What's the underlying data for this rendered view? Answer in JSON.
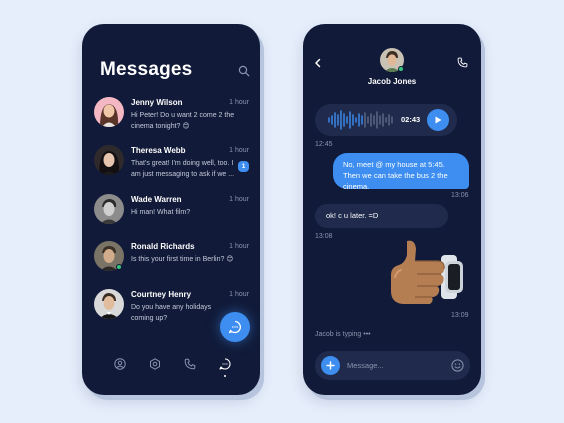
{
  "messages_screen": {
    "title": "Messages",
    "conversations": [
      {
        "name": "Jenny Wilson",
        "time": "1 hour",
        "preview": "Hi Peter! Do u want 2 come 2 the\ncinema tonight? 😊",
        "unread": "",
        "online": false
      },
      {
        "name": "Theresa Webb",
        "time": "1 hour",
        "preview": "That's great! I'm doing well, too. I\nam just messaging to ask if we ...",
        "unread": "1",
        "online": false
      },
      {
        "name": "Wade Warren",
        "time": "1 hour",
        "preview": "Hi man! What film?",
        "unread": "",
        "online": false
      },
      {
        "name": "Ronald Richards",
        "time": "1 hour",
        "preview": "Is this your first time in Berlin? 😊",
        "unread": "",
        "online": true
      },
      {
        "name": "Courtney Henry",
        "time": "1 hour",
        "preview": "Do you have any holidays\ncoming up?",
        "unread": "",
        "online": false
      }
    ],
    "bottom_nav": [
      "profile-icon",
      "settings-icon",
      "phone-icon",
      "chat-icon"
    ],
    "active_nav": "chat-icon"
  },
  "chat_screen": {
    "contact_name": "Jacob Jones",
    "contact_online": true,
    "voice_message": {
      "duration": "02:43",
      "time": "12:45"
    },
    "outgoing_message": {
      "text": "No, meet @ my house at 5:45. Then we can take the bus 2 the cinema.",
      "time": "13:06"
    },
    "incoming_message": {
      "text": "ok! c u later. =D",
      "time": "13:08"
    },
    "sticker": {
      "name": "thumbs-up-sticker",
      "time": "13:09"
    },
    "typing_indicator": "Jacob is typing",
    "composer": {
      "placeholder": "Message...",
      "value": ""
    }
  },
  "colors": {
    "background": "#e6eefb",
    "phone": "#111a38",
    "bubble_dark": "#1f2a4d",
    "accent": "#3d8ef0",
    "online": "#34c77b"
  }
}
